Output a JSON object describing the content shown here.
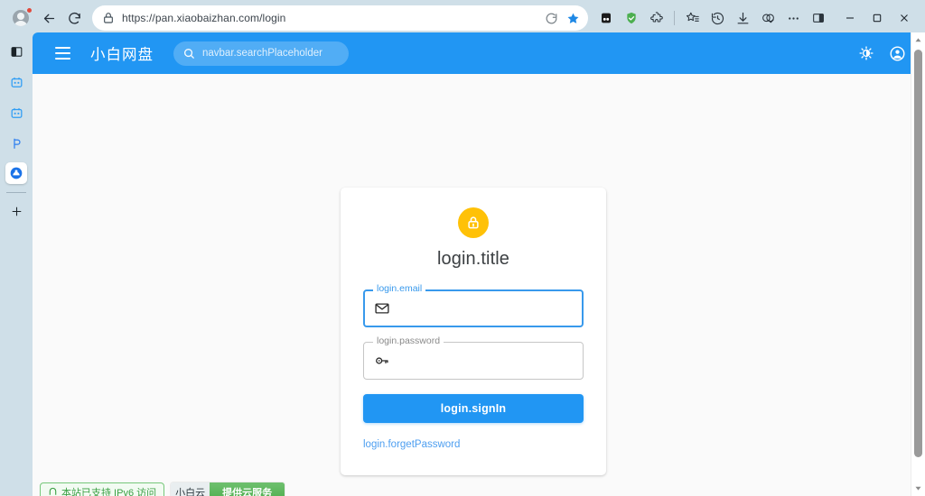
{
  "browser": {
    "name": "microsoft-edge",
    "profile_has_notification": true,
    "url": "https://pan.xiaobaizhan.com/login",
    "back_icon": "back-arrow-icon",
    "reload_icon": "reload-icon",
    "lock_icon": "site-lock-icon",
    "urlbar_icons": [
      {
        "name": "refresh-page-icon",
        "glyph": "refresh"
      },
      {
        "name": "favorite-star-icon",
        "glyph": "star-filled"
      }
    ],
    "toolbar_icons": [
      {
        "name": "extension-dark-icon",
        "label": "extension"
      },
      {
        "name": "shield-extension-icon",
        "label": "adblock-shield"
      },
      {
        "name": "puzzle-extensions-icon",
        "label": "extensions"
      },
      {
        "name": "favorites-icon",
        "label": "Favorites"
      },
      {
        "name": "history-icon",
        "label": "History"
      },
      {
        "name": "downloads-icon",
        "label": "Downloads"
      },
      {
        "name": "collections-icon",
        "label": "Collections"
      },
      {
        "name": "settings-more-icon",
        "label": "Settings and more"
      },
      {
        "name": "split-screen-icon",
        "label": "Split screen"
      }
    ],
    "window_controls": [
      {
        "name": "minimize-button",
        "glyph": "–"
      },
      {
        "name": "maximize-button",
        "glyph": "☐"
      },
      {
        "name": "close-button",
        "glyph": "✕"
      }
    ],
    "sidebar_items": [
      {
        "name": "sidebar-panel-toggle-icon",
        "label": "panel"
      },
      {
        "name": "sidebar-tool-calendar-icon",
        "label": "tool-1"
      },
      {
        "name": "sidebar-tool-calendar2-icon",
        "label": "tool-2"
      },
      {
        "name": "sidebar-copilot-icon",
        "label": "copilot"
      },
      {
        "name": "sidebar-app-active-icon",
        "label": "active-app",
        "active": true
      },
      {
        "name": "sidebar-add-icon",
        "label": "add",
        "glyph": "+"
      }
    ]
  },
  "navbar": {
    "menu_icon": "hamburger-menu-icon",
    "brand": "小白网盘",
    "searchPlaceholder": "navbar.searchPlaceholder",
    "search_icon": "search-icon",
    "theme_toggle_icon": "brightness-theme-icon",
    "account_icon": "account-circle-icon",
    "bg_color": "#2196f3"
  },
  "login": {
    "lock_icon": "lock-icon",
    "lock_color": "#ffc107",
    "title": "login.title",
    "email": "login.email",
    "email_icon": "envelope-icon",
    "email_value": "",
    "email_focused": true,
    "password": "login.password",
    "password_icon": "key-icon",
    "password_value": "",
    "signIn": "login.signIn",
    "forgetPassword": "login.forgetPassword",
    "accent_color": "#2196f3",
    "link_color": "#4d9ef0"
  },
  "footer": {
    "ipv6_badge": "本站已支持 IPv6 访问",
    "ipv6_icon": "ipv6-shield-icon",
    "cloud_badge_left": "小白云",
    "cloud_badge_right": "提供云服务",
    "green_color": "#5cb85c"
  },
  "scrollbar": {
    "up_arrow": "scroll-up-arrow-icon",
    "down_arrow": "scroll-down-arrow-icon",
    "thumb": "scroll-thumb"
  }
}
